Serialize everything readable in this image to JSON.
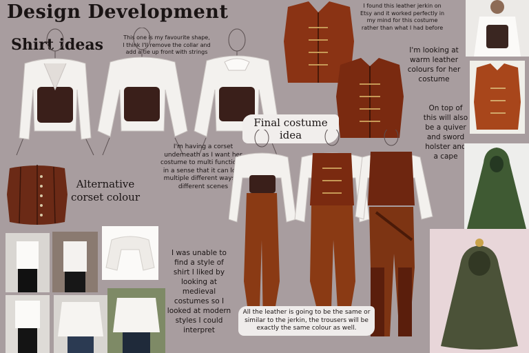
{
  "header": {
    "title": "Design Development",
    "subtitle": "Shirt ideas"
  },
  "notes": {
    "favourite_shape": "This one is my favourite shape, I think I'll remove the collar and add a tie up front with strings",
    "jerkin_etsy": "I found this leather jerkin on Etsy and it worked perfectly in my mind for this costume rather than what I had before",
    "warm_leather": "I'm looking at warm leather colours for her costume",
    "on_top": "On top of this will also be a quiver and sword holster and a cape",
    "corset_underneath": "I'm having a corset underneath as I want her costume to multi functional in a sense that it can look multiple different ways in different scenes",
    "alternative_corset": "Alternative corset colour",
    "medieval_shirt": "I was unable to find a style of shirt I liked by looking at medieval costumes so I looked at modern styles I could interpret",
    "final_costume": "Final costume idea",
    "leather_same": "All the leather is going to be the same or similar to the jerkin, the trousers will be exactly the same colour as well."
  },
  "colors": {
    "background": "#a89d9f",
    "leather": "#7a2d12",
    "leather_light": "#a9441c",
    "corset": "#3a1f1a",
    "shirt": "#f3f1ee",
    "cape": "#3f5a33",
    "cape_dark": "#4b5238",
    "trousers": "#8a3a14"
  }
}
